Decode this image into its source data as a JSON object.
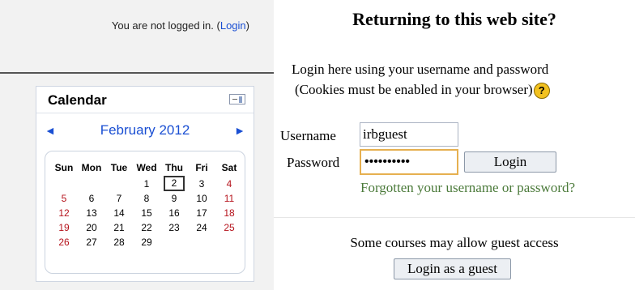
{
  "login_info": {
    "prefix": "You are not logged in. (",
    "link": "Login",
    "suffix": ")"
  },
  "calendar": {
    "title": "Calendar",
    "month": "February 2012",
    "prev_icon": "◄",
    "next_icon": "►",
    "weekdays": [
      "Sun",
      "Mon",
      "Tue",
      "Wed",
      "Thu",
      "Fri",
      "Sat"
    ],
    "weeks": [
      [
        "",
        "",
        "",
        "1",
        "2",
        "3",
        "4"
      ],
      [
        "5",
        "6",
        "7",
        "8",
        "9",
        "10",
        "11"
      ],
      [
        "12",
        "13",
        "14",
        "15",
        "16",
        "17",
        "18"
      ],
      [
        "19",
        "20",
        "21",
        "22",
        "23",
        "24",
        "25"
      ],
      [
        "26",
        "27",
        "28",
        "29",
        "",
        "",
        ""
      ]
    ],
    "today": "2",
    "weekend_color": "#b5121b",
    "link_color": "#1a4fd3"
  },
  "login_form": {
    "heading": "Returning to this web site?",
    "intro_line1": "Login here using your username and password",
    "intro_line2": "(Cookies must be enabled in your browser)",
    "help_icon": "?",
    "username_label": "Username",
    "username_value": "irbguest",
    "password_label": "Password",
    "password_value": "••••••••••",
    "login_button": "Login",
    "forgot_link": "Forgotten your username or password?"
  },
  "guest": {
    "text": "Some courses may allow guest access",
    "button": "Login as a guest"
  }
}
